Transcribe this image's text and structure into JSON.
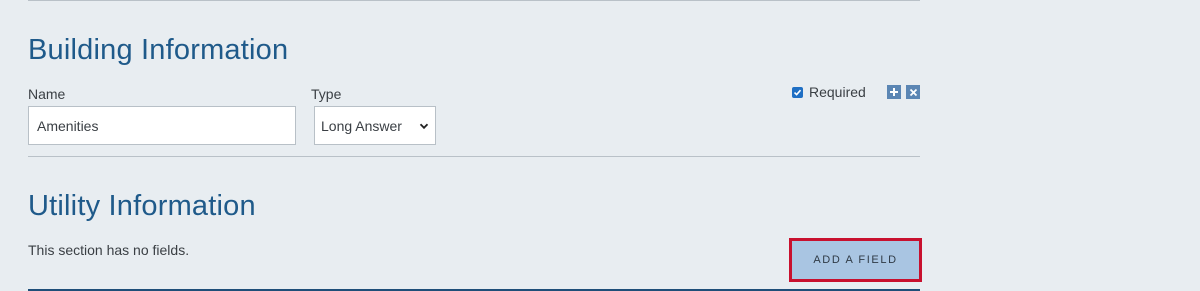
{
  "sections": [
    {
      "title": "Building Information",
      "field": {
        "name_label": "Name",
        "name_value": "Amenities",
        "type_label": "Type",
        "type_value": "Long Answer",
        "required_label": "Required",
        "required_checked": true
      }
    },
    {
      "title": "Utility Information",
      "empty_message": "This section has no fields.",
      "add_button_label": "ADD A FIELD"
    }
  ],
  "icons": {
    "add": "plus-icon",
    "remove": "close-icon",
    "select": "chevron-down-icon"
  },
  "colors": {
    "accent_title": "#1f5a8a",
    "checkbox": "#1f6fc4",
    "icon_button": "#5b86b4",
    "add_button": "#a9c5e2",
    "highlight_border": "#c8102e"
  }
}
